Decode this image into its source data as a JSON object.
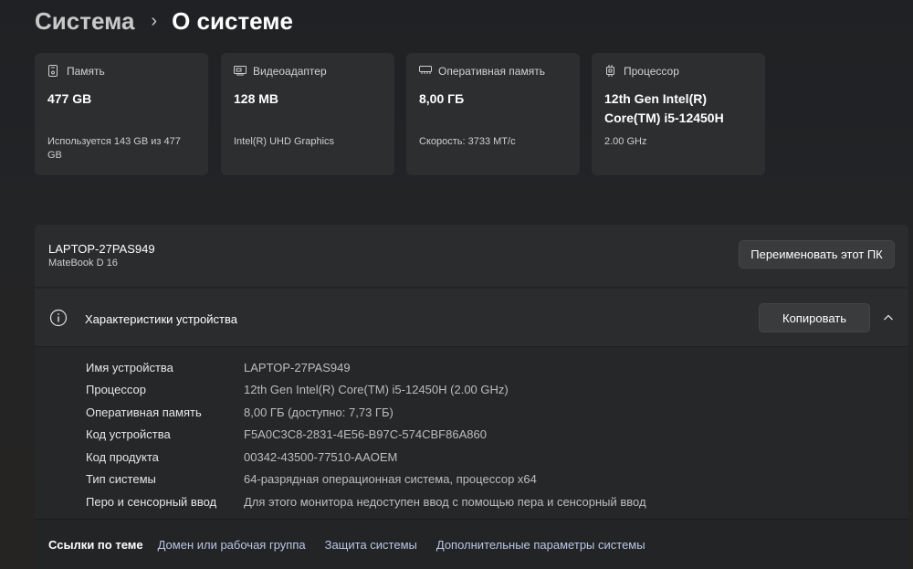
{
  "breadcrumb": {
    "parent": "Система",
    "separator": "›",
    "current": "О системе"
  },
  "cards": [
    {
      "icon": "storage-icon",
      "title": "Память",
      "value": "477 GB",
      "sub": "Используется 143 GB из 477 GB"
    },
    {
      "icon": "display-adapter-icon",
      "title": "Видеоадаптер",
      "value": "128 MB",
      "sub": "Intel(R) UHD Graphics"
    },
    {
      "icon": "ram-icon",
      "title": "Оперативная память",
      "value": "8,00 ГБ",
      "sub": "Скорость: 3733 МТ/с"
    },
    {
      "icon": "processor-icon",
      "title": "Процессор",
      "value": "12th Gen Intel(R) Core(TM) i5-12450H",
      "sub": "2.00 GHz"
    }
  ],
  "pc": {
    "name": "LAPTOP-27PAS949",
    "model": "MateBook D 16",
    "rename_label": "Переименовать этот ПК"
  },
  "specs": {
    "title": "Характеристики устройства",
    "copy_label": "Копировать",
    "rows": [
      {
        "label": "Имя устройства",
        "value": "LAPTOP-27PAS949"
      },
      {
        "label": "Процессор",
        "value": "12th Gen Intel(R) Core(TM) i5-12450H (2.00 GHz)"
      },
      {
        "label": "Оперативная память",
        "value": "8,00 ГБ (доступно: 7,73 ГБ)"
      },
      {
        "label": "Код устройства",
        "value": "F5A0C3C8-2831-4E56-B97C-574CBF86A860"
      },
      {
        "label": "Код продукта",
        "value": "00342-43500-77510-AAOEM"
      },
      {
        "label": "Тип системы",
        "value": "64-разрядная операционная система, процессор x64"
      },
      {
        "label": "Перо и сенсорный ввод",
        "value": "Для этого монитора недоступен ввод с помощью пера и сенсорный ввод"
      }
    ]
  },
  "related_links": {
    "title": "Ссылки по теме",
    "items": [
      "Домен или рабочая группа",
      "Защита системы",
      "Дополнительные параметры системы"
    ]
  },
  "colors": {
    "background": "#232426",
    "card": "#2d2e30",
    "link": "#b9c6e6"
  }
}
